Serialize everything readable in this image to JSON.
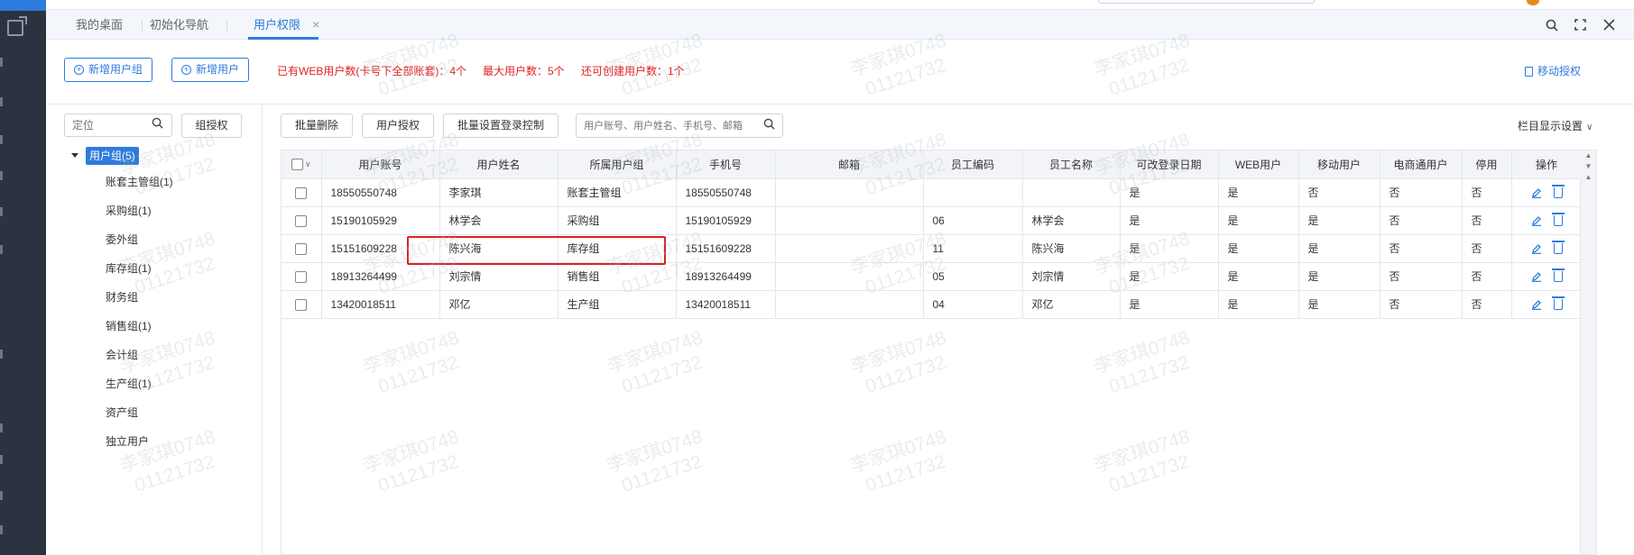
{
  "tabs": [
    {
      "label": "我的桌面",
      "active": false
    },
    {
      "label": "初始化导航",
      "active": false
    },
    {
      "label": "用户权限",
      "active": true
    }
  ],
  "tab_close_glyph": "×",
  "top_tools": [
    "search-icon",
    "fullscreen-icon",
    "close-icon"
  ],
  "actions": {
    "add_group": "新增用户组",
    "add_user": "新增用户",
    "stat_web_users": "已有WEB用户数(卡号下全部账套)：4个",
    "stat_max_users": "最大用户数：5个",
    "stat_remaining": "还可创建用户数：1个",
    "mobile_auth": "移动授权"
  },
  "tree": {
    "search_placeholder": "定位",
    "group_auth_button": "组授权",
    "root": "用户组(5)",
    "nodes": [
      "账套主管组(1)",
      "采购组(1)",
      "委外组",
      "库存组(1)",
      "财务组",
      "销售组(1)",
      "会计组",
      "生产组(1)",
      "资产组",
      "独立用户"
    ]
  },
  "table_toolbar": {
    "batch_delete": "批量删除",
    "user_auth": "用户授权",
    "batch_login_ctrl": "批量设置登录控制",
    "search_placeholder": "用户账号、用户姓名、手机号、邮箱",
    "column_settings": "栏目显示设置"
  },
  "columns": [
    "用户账号",
    "用户姓名",
    "所属用户组",
    "手机号",
    "邮箱",
    "员工编码",
    "员工名称",
    "可改登录日期",
    "WEB用户",
    "移动用户",
    "电商通用户",
    "停用",
    "操作"
  ],
  "rows": [
    [
      "18550550748",
      "李家琪",
      "账套主管组",
      "18550550748",
      "",
      "",
      "",
      "是",
      "是",
      "否",
      "否",
      "否"
    ],
    [
      "15190105929",
      "林学会",
      "采购组",
      "15190105929",
      "",
      "06",
      "林学会",
      "是",
      "是",
      "是",
      "否",
      "否"
    ],
    [
      "15151609228",
      "陈兴海",
      "库存组",
      "15151609228",
      "",
      "11",
      "陈兴海",
      "是",
      "是",
      "是",
      "否",
      "否"
    ],
    [
      "18913264499",
      "刘宗情",
      "销售组",
      "18913264499",
      "",
      "05",
      "刘宗情",
      "是",
      "是",
      "是",
      "否",
      "否"
    ],
    [
      "13420018511",
      "邓亿",
      "生产组",
      "13420018511",
      "",
      "04",
      "邓亿",
      "是",
      "是",
      "是",
      "否",
      "否"
    ]
  ],
  "watermark": {
    "line1": "李家琪0748",
    "line2": "01121732"
  },
  "colors": {
    "accent": "#2d7bdc",
    "alert": "#e02020",
    "rail": "#2b3340"
  }
}
